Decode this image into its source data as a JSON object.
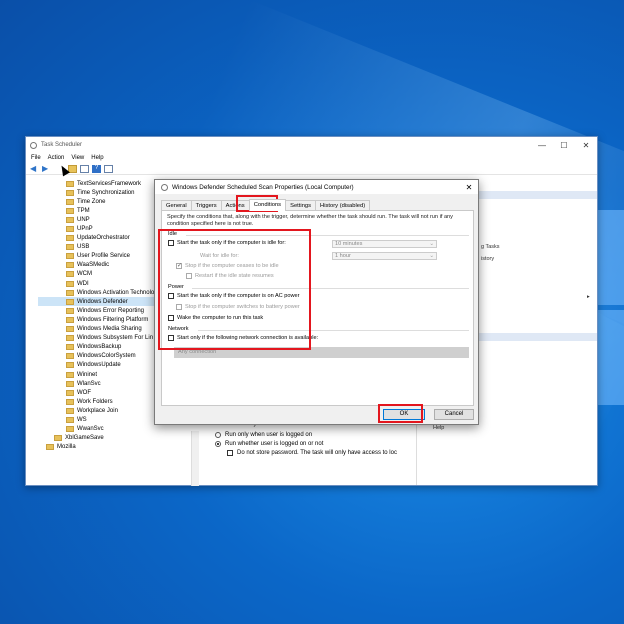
{
  "colors": {
    "highlight": "#e3161e",
    "accent": "#0078d7",
    "desktop": "#0b67c8"
  },
  "task_scheduler": {
    "title": "Task Scheduler",
    "window_controls": [
      "—",
      "☐",
      "✕"
    ],
    "menu": [
      "File",
      "Action",
      "View",
      "Help"
    ],
    "tree": [
      "TextServicesFramework",
      "Time Synchronization",
      "Time Zone",
      "TPM",
      "UNP",
      "UPnP",
      "UpdateOrchestrator",
      "USB",
      "User Profile Service",
      "WaaSMedic",
      "WCM",
      "WDI",
      "Windows Activation Technolo",
      "Windows Defender",
      "Windows Error Reporting",
      "Windows Filtering Platform",
      "Windows Media Sharing",
      "Windows Subsystem For Lin",
      "WindowsBackup",
      "WindowsColorSystem",
      "WindowsUpdate",
      "Wininet",
      "WlanSvc",
      "WOF",
      "Work Folders",
      "Workplace Join",
      "WS",
      "WwanSvc"
    ],
    "tree_selected_index": 13,
    "tree_bottom": [
      "XblGameSave",
      "Mozilla"
    ],
    "actions_fragments": [
      "g Tasks",
      "istory",
      "Help"
    ],
    "general_fragment": {
      "security_label": "ecurity",
      "run_logged_on": "Run only when user is logged on",
      "run_whether": "Run whether user is logged on or not",
      "no_store_password": "Do not store password.  The task will only have access to loc"
    }
  },
  "dialog": {
    "title": "Windows Defender Scheduled Scan Properties (Local Computer)",
    "close": "✕",
    "tabs": [
      "General",
      "Triggers",
      "Actions",
      "Conditions",
      "Settings",
      "History (disabled)"
    ],
    "active_tab": "Conditions",
    "description": "Specify the conditions that, along with the trigger, determine whether the task should run.  The task will not run  if any condition specified here is not true.",
    "idle": {
      "label": "Idle",
      "start_if_idle": "Start the task only if the computer is idle for:",
      "idle_duration": "10 minutes",
      "wait_for_idle": "Wait for idle for:",
      "wait_duration": "1 hour",
      "stop_if_not_idle": "Stop if the computer ceases to be idle",
      "restart_if_idle": "Restart if the idle state resumes"
    },
    "power": {
      "label": "Power",
      "ac_power": "Start the task only if the computer is on AC power",
      "stop_on_battery": "Stop if the computer switches to battery power",
      "wake": "Wake the computer to run this task"
    },
    "network": {
      "label": "Network",
      "only_if_network": "Start only if the following network connection is available:",
      "connection": "Any connection"
    },
    "ok": "OK",
    "cancel": "Cancel"
  }
}
